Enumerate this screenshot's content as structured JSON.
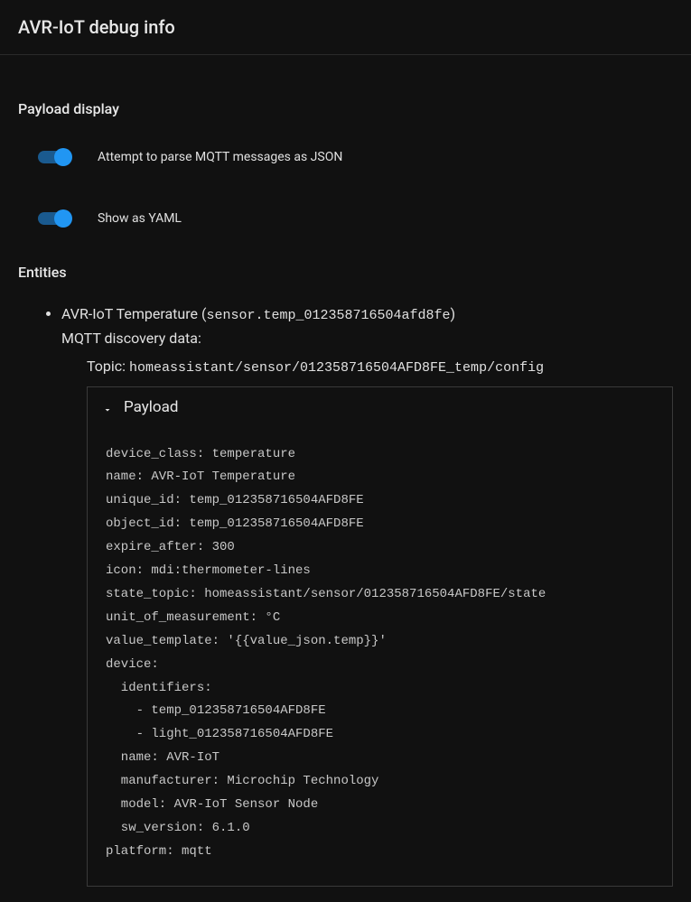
{
  "header": {
    "title": "AVR-IoT debug info"
  },
  "sections": {
    "payload_display": {
      "title": "Payload display",
      "toggles": {
        "parse_json": {
          "label": "Attempt to parse MQTT messages as JSON",
          "enabled": true
        },
        "show_yaml": {
          "label": "Show as YAML",
          "enabled": true
        }
      }
    },
    "entities": {
      "title": "Entities",
      "items": [
        {
          "name": "AVR-IoT Temperature",
          "entity_id": "sensor.temp_012358716504afd8fe",
          "discovery_label": "MQTT discovery data:",
          "topic_label": "Topic:",
          "topic": "homeassistant/sensor/012358716504AFD8FE_temp/config",
          "payload_heading": "Payload",
          "payload_yaml": "device_class: temperature\nname: AVR-IoT Temperature\nunique_id: temp_012358716504AFD8FE\nobject_id: temp_012358716504AFD8FE\nexpire_after: 300\nicon: mdi:thermometer-lines\nstate_topic: homeassistant/sensor/012358716504AFD8FE/state\nunit_of_measurement: °C\nvalue_template: '{{value_json.temp}}'\ndevice:\n  identifiers:\n    - temp_012358716504AFD8FE\n    - light_012358716504AFD8FE\n  name: AVR-IoT\n  manufacturer: Microchip Technology\n  model: AVR-IoT Sensor Node\n  sw_version: 6.1.0\nplatform: mqtt"
        }
      ]
    }
  }
}
